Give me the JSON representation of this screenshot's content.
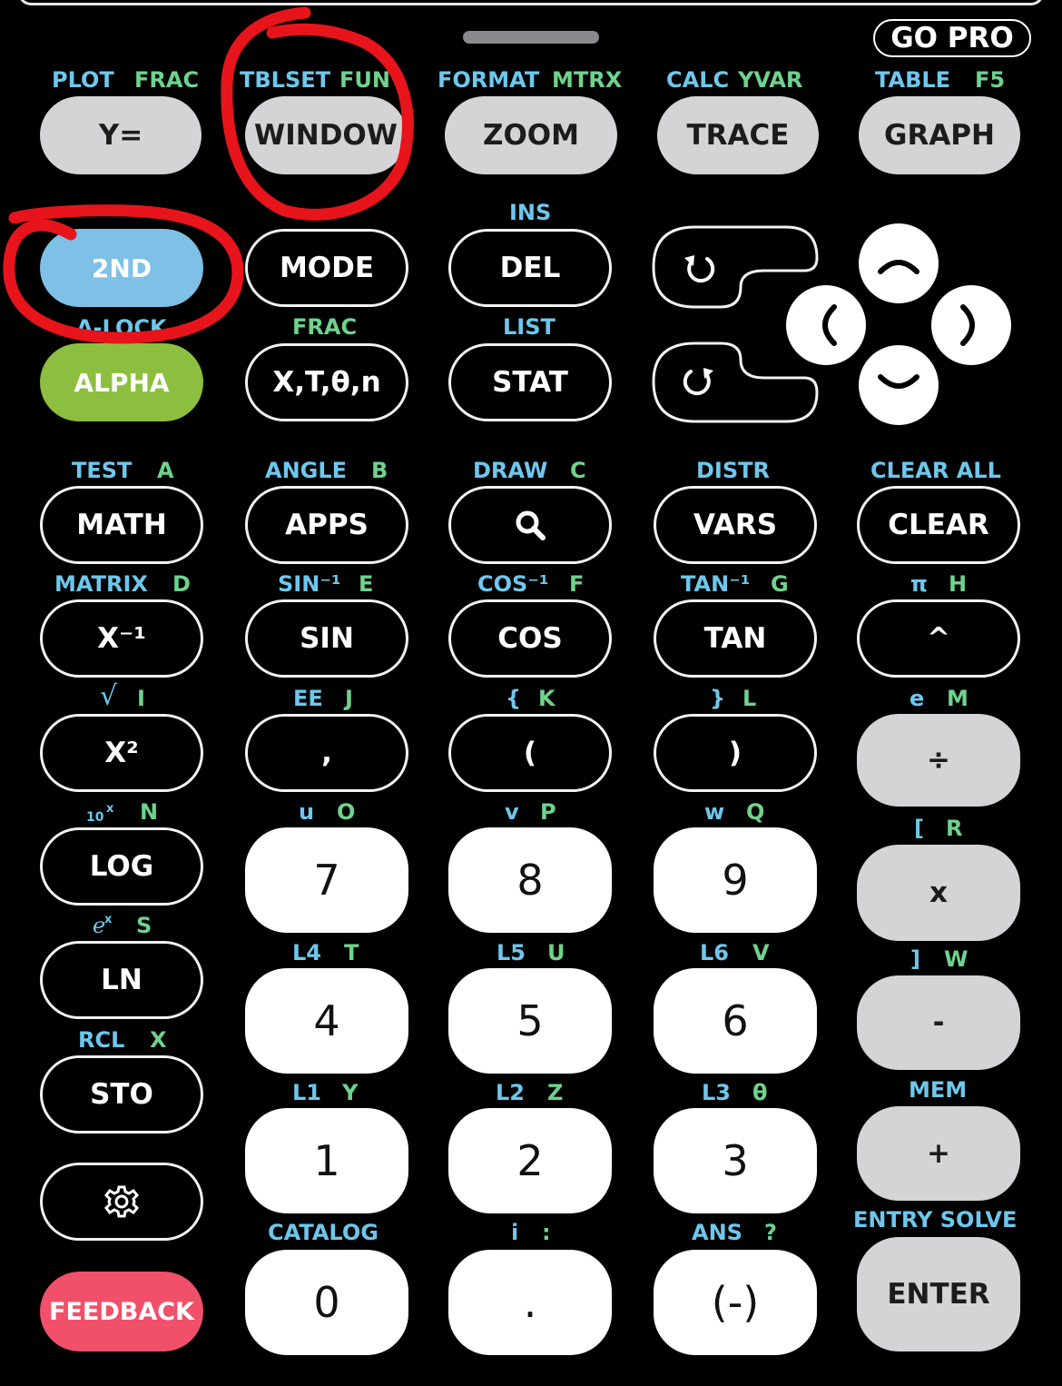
{
  "top": {
    "go_pro": "GO PRO"
  },
  "row1": {
    "labels": [
      {
        "a": "PLOT",
        "b": "FRAC"
      },
      {
        "a": "TBLSET",
        "b": "FUN"
      },
      {
        "a": "FORMAT",
        "b": "MTRX"
      },
      {
        "a": "CALC",
        "b": "YVAR"
      },
      {
        "a": "TABLE",
        "b": "F5"
      }
    ],
    "keys": [
      "Y=",
      "WINDOW",
      "ZOOM",
      "TRACE",
      "GRAPH"
    ]
  },
  "row2": {
    "second": "2ND",
    "mode": "MODE",
    "del_above": "INS",
    "del": "DEL"
  },
  "row3": {
    "alpha_above": "A-LOCK",
    "alpha": "ALPHA",
    "xt_above": "FRAC",
    "xt": "X,T,θ,n",
    "stat_above": "LIST",
    "stat": "STAT"
  },
  "row4": {
    "labels": [
      {
        "a": "TEST",
        "b": "A"
      },
      {
        "a": "ANGLE",
        "b": "B"
      },
      {
        "a": "DRAW",
        "b": "C"
      },
      {
        "a": "DISTR",
        "b": ""
      },
      {
        "a": "CLEAR ALL",
        "b": ""
      }
    ],
    "keys": [
      "MATH",
      "APPS",
      "",
      "VARS",
      "CLEAR"
    ]
  },
  "row5": {
    "labels": [
      {
        "a": "MATRIX",
        "b": "D"
      },
      {
        "a": "SIN⁻¹",
        "b": "E"
      },
      {
        "a": "COS⁻¹",
        "b": "F"
      },
      {
        "a": "TAN⁻¹",
        "b": "G"
      },
      {
        "a": "π",
        "b": "H"
      }
    ],
    "keys": [
      "X⁻¹",
      "SIN",
      "COS",
      "TAN",
      "^"
    ]
  },
  "row6": {
    "labels": [
      {
        "a": "√",
        "b": "I"
      },
      {
        "a": "EE",
        "b": "J"
      },
      {
        "a": "{",
        "b": "K"
      },
      {
        "a": "}",
        "b": "L"
      },
      {
        "a": "e",
        "b": "M"
      }
    ],
    "keys": [
      "X²",
      ",",
      "(",
      ")",
      "÷"
    ]
  },
  "row7": {
    "labels": [
      {
        "a": "10",
        "sup": "x",
        "b": "N"
      },
      {
        "a": "u",
        "b": "O"
      },
      {
        "a": "v",
        "b": "P"
      },
      {
        "a": "w",
        "b": "Q"
      },
      {
        "a": "[",
        "b": "R"
      }
    ],
    "keys": [
      "LOG",
      "7",
      "8",
      "9",
      "x"
    ]
  },
  "row8": {
    "labels": [
      {
        "a": "e",
        "sup": "x",
        "b": "S"
      },
      {
        "a": "L4",
        "b": "T"
      },
      {
        "a": "L5",
        "b": "U"
      },
      {
        "a": "L6",
        "b": "V"
      },
      {
        "a": "]",
        "b": "W"
      }
    ],
    "keys": [
      "LN",
      "4",
      "5",
      "6",
      "-"
    ]
  },
  "row9": {
    "labels": [
      {
        "a": "RCL",
        "b": "X"
      },
      {
        "a": "L1",
        "b": "Y"
      },
      {
        "a": "L2",
        "b": "Z"
      },
      {
        "a": "L3",
        "b": "θ"
      },
      {
        "a": "MEM",
        "b": ""
      }
    ],
    "keys": [
      "STO",
      "1",
      "2",
      "3",
      "+"
    ]
  },
  "row10": {
    "labels": [
      {
        "a": "",
        "b": ""
      },
      {
        "a": "CATALOG",
        "b": ""
      },
      {
        "a": "i",
        "b": ":"
      },
      {
        "a": "ANS",
        "b": "?"
      },
      {
        "a": "ENTRY SOLVE",
        "b": ""
      }
    ],
    "keys": [
      "",
      "0",
      ".",
      "(-)",
      "ENTER"
    ],
    "feedback": "FEEDBACK"
  },
  "icons": [
    "undo-icon",
    "redo-icon",
    "search-icon",
    "settings-icon",
    "arrow-up-icon",
    "arrow-left-icon",
    "arrow-right-icon",
    "arrow-down-icon"
  ],
  "colors": {
    "cyan": "#6ec7ec",
    "green": "#6ed38c",
    "second": "#7ec0e6",
    "alpha": "#8cbf3f",
    "feedback": "#f0506a",
    "annotation": "#e8141b"
  }
}
